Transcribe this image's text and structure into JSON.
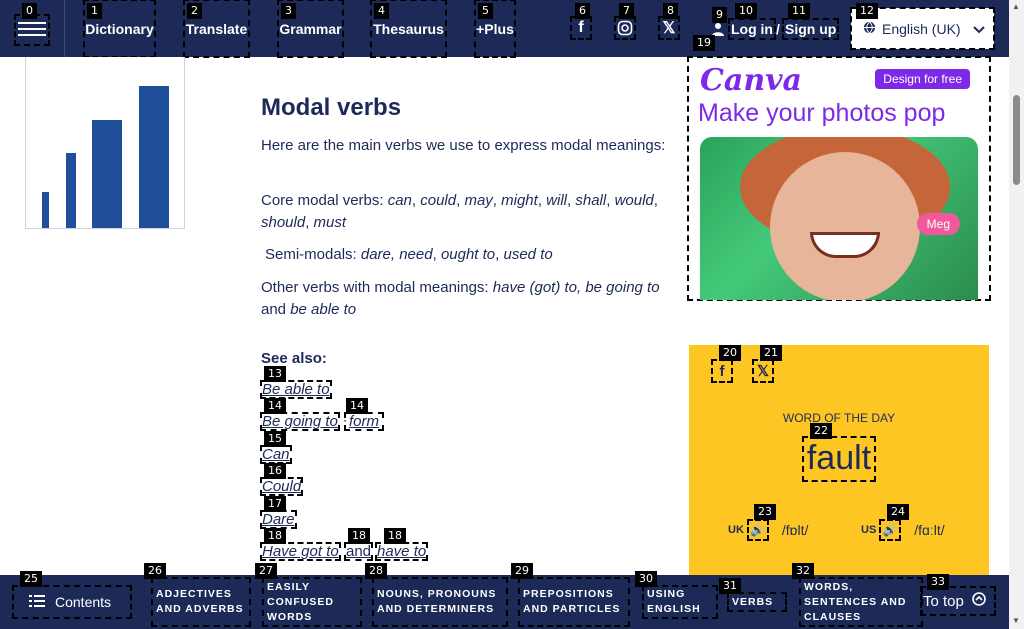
{
  "topbar": {
    "nav": [
      {
        "label": "Dictionary",
        "badge": "1"
      },
      {
        "label": "Translate",
        "badge": "2"
      },
      {
        "label": "Grammar",
        "badge": "3"
      },
      {
        "label": "Thesaurus",
        "badge": "4"
      },
      {
        "label": "+Plus",
        "badge": "5"
      }
    ],
    "menu_badge": "0",
    "social_badges": [
      "6",
      "7",
      "8"
    ],
    "login_label": "Log in",
    "separator": "/",
    "signup_label": "Sign up",
    "login_badge": "10",
    "signup_badge": "11",
    "user_badge": "9",
    "language": "English (UK)",
    "language_badge": "12"
  },
  "article": {
    "title": "Modal verbs",
    "intro": "Here are the main verbs we use to express modal meanings:",
    "core_label": "Core modal verbs: ",
    "core_items": [
      "can",
      "could",
      "may",
      "might",
      "will",
      "shall",
      "would",
      "should",
      "must"
    ],
    "semi_label": "Semi-modals: ",
    "semi_items": [
      "dare, need",
      "ought to",
      "used to"
    ],
    "other_label": "Other verbs with modal meanings: ",
    "other_items": [
      "have (got) to, be going to",
      "be able to"
    ],
    "and_word": "and",
    "see_also": "See also:",
    "links": [
      {
        "text": "Be able to",
        "badge": "13"
      },
      {
        "text": "Be going to",
        "badge": "14"
      },
      {
        "text": "form",
        "badge": "14"
      },
      {
        "text": "Can",
        "badge": "15"
      },
      {
        "text": "Could",
        "badge": "16"
      },
      {
        "text": "Dare",
        "badge": "17"
      },
      {
        "text": "Have got to",
        "badge": "18"
      },
      {
        "text": "and",
        "badge": "18"
      },
      {
        "text": "have to",
        "badge": "18"
      }
    ],
    "separator_semi": ";"
  },
  "ad": {
    "brand": "Canva",
    "cta": "Design for free",
    "headline": "Make your photos pop",
    "tag": "Meg",
    "badge": "19"
  },
  "wotd": {
    "facebook_badge": "20",
    "x_badge": "21",
    "label": "WORD OF THE DAY",
    "word": "fault",
    "word_badge": "22",
    "uk_label": "UK",
    "uk_pron": "/fɒlt/",
    "uk_badge": "23",
    "us_label": "US",
    "us_pron": "/fɑːlt/",
    "us_badge": "24"
  },
  "bottombar": {
    "contents_label": "Contents",
    "contents_badge": "25",
    "items": [
      {
        "label": "Adjectives and adverbs",
        "badge": "26"
      },
      {
        "label": "Easily confused words",
        "badge": "27"
      },
      {
        "label": "Nouns, pronouns and determiners",
        "badge": "28"
      },
      {
        "label": "Prepositions and particles",
        "badge": "29"
      },
      {
        "label": "Using English",
        "badge": "30"
      },
      {
        "label": "Verbs",
        "badge": "31"
      },
      {
        "label": "Words, sentences and clauses",
        "badge": "32"
      }
    ],
    "to_top_label": "To top",
    "to_top_badge": "33"
  },
  "colors": {
    "navy": "#1d2a57",
    "yellow": "#fec623",
    "canva_purple": "#7d2ae8"
  }
}
